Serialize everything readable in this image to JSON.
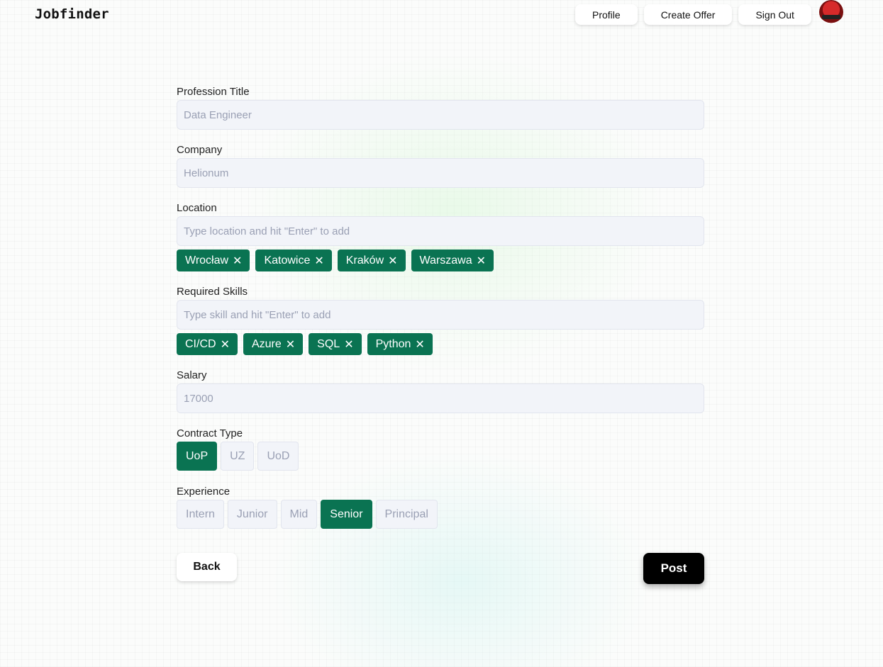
{
  "header": {
    "logo": "Jobfinder",
    "nav": [
      "Profile",
      "Create Offer",
      "Sign Out"
    ]
  },
  "form": {
    "profession": {
      "label": "Profession Title",
      "value": "Data Engineer"
    },
    "company": {
      "label": "Company",
      "value": "Helionum"
    },
    "location": {
      "label": "Location",
      "placeholder": "Type location and hit \"Enter\" to add",
      "tags": [
        "Wrocław",
        "Katowice",
        "Kraków",
        "Warszawa"
      ]
    },
    "skills": {
      "label": "Required Skills",
      "placeholder": "Type skill and hit \"Enter\" to add",
      "tags": [
        "CI/CD",
        "Azure",
        "SQL",
        "Python"
      ]
    },
    "salary": {
      "label": "Salary",
      "value": "17000"
    },
    "contract": {
      "label": "Contract Type",
      "options": [
        "UoP",
        "UZ",
        "UoD"
      ],
      "selected": "UoP"
    },
    "experience": {
      "label": "Experience",
      "options": [
        "Intern",
        "Junior",
        "Mid",
        "Senior",
        "Principal"
      ],
      "selected": "Senior"
    }
  },
  "actions": {
    "back": "Back",
    "post": "Post"
  },
  "icons": {
    "remove": "close-icon"
  },
  "colors": {
    "accent": "#0a7352",
    "primary_button": "#000000"
  }
}
